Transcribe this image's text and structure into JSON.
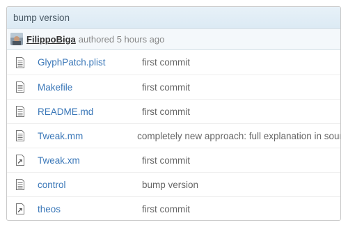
{
  "commit": {
    "message": "bump version",
    "author": "FilippoBiga",
    "authored_text": "authored 5 hours ago"
  },
  "files": [
    {
      "name": "GlyphPatch.plist",
      "message": "first commit",
      "icon": "file-text-icon"
    },
    {
      "name": "Makefile",
      "message": "first commit",
      "icon": "file-text-icon"
    },
    {
      "name": "README.md",
      "message": "first commit",
      "icon": "file-text-icon"
    },
    {
      "name": "Tweak.mm",
      "message": "completely new approach: full explanation in sourc",
      "icon": "file-text-icon"
    },
    {
      "name": "Tweak.xm",
      "message": "first commit",
      "icon": "symlink-file-icon"
    },
    {
      "name": "control",
      "message": "bump version",
      "icon": "file-text-icon"
    },
    {
      "name": "theos",
      "message": "first commit",
      "icon": "symlink-file-icon"
    }
  ]
}
